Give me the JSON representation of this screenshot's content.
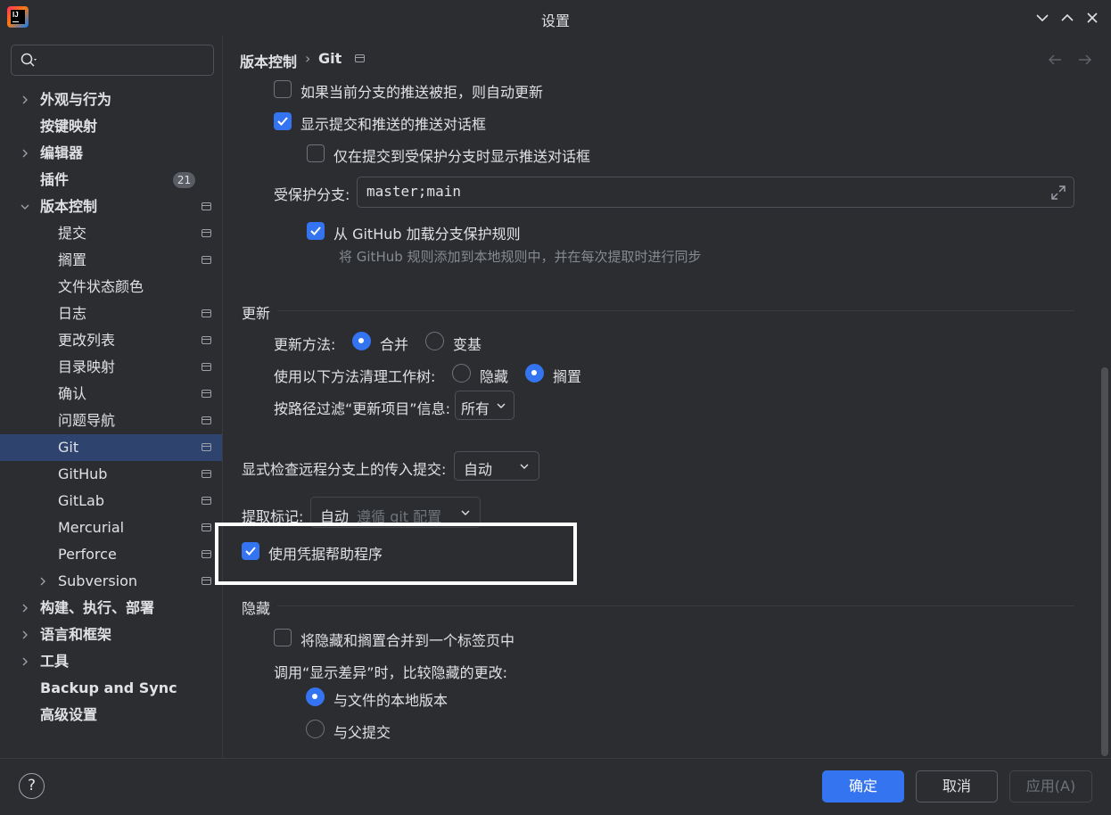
{
  "window": {
    "title": "设置"
  },
  "sidebar": {
    "search_placeholder": "",
    "items": [
      {
        "label": "外观与行为",
        "expandable": true,
        "bold": true
      },
      {
        "label": "按键映射",
        "bold": true
      },
      {
        "label": "编辑器",
        "expandable": true,
        "bold": true
      },
      {
        "label": "插件",
        "bold": true,
        "badge": "21"
      },
      {
        "label": "版本控制",
        "expanded": true,
        "bold": true
      },
      {
        "label": "提交"
      },
      {
        "label": "搁置"
      },
      {
        "label": "文件状态颜色"
      },
      {
        "label": "日志"
      },
      {
        "label": "更改列表"
      },
      {
        "label": "目录映射"
      },
      {
        "label": "确认"
      },
      {
        "label": "问题导航"
      },
      {
        "label": "Git",
        "selected": true
      },
      {
        "label": "GitHub"
      },
      {
        "label": "GitLab"
      },
      {
        "label": "Mercurial"
      },
      {
        "label": "Perforce"
      },
      {
        "label": "Subversion",
        "expandable": true
      },
      {
        "label": "构建、执行、部署",
        "expandable": true,
        "bold": true
      },
      {
        "label": "语言和框架",
        "expandable": true,
        "bold": true
      },
      {
        "label": "工具",
        "expandable": true,
        "bold": true
      },
      {
        "label": "Backup and Sync",
        "bold": true
      },
      {
        "label": "高级设置",
        "bold": true
      }
    ]
  },
  "breadcrumb": {
    "parent": "版本控制",
    "separator": "›",
    "current": "Git"
  },
  "push": {
    "auto_update_label": "如果当前分支的推送被拒，则自动更新",
    "show_push_dialog_label": "显示提交和推送的推送对话框",
    "protected_only_label": "仅在提交到受保护分支时显示推送对话框",
    "protected_branches_label": "受保护分支:",
    "protected_branches_value": "master;main",
    "github_rules_label": "从 GitHub 加载分支保护规则",
    "github_rules_hint": "将 GitHub 规则添加到本地规则中，并在每次提取时进行同步"
  },
  "update": {
    "section_title": "更新",
    "method_label": "更新方法:",
    "merge_label": "合并",
    "rebase_label": "变基",
    "clean_label": "使用以下方法清理工作树:",
    "stash_label": "隐藏",
    "shelve_label": "搁置",
    "filter_label": "按路径过滤“更新项目”信息:",
    "filter_value": "所有"
  },
  "incoming": {
    "label": "显式检查远程分支上的传入提交:",
    "value": "自动"
  },
  "fetch_tags": {
    "label": "提取标记:",
    "value": "自动",
    "value_hint": "遵循 git 配置"
  },
  "credential_helper_label": "使用凭据帮助程序",
  "stash": {
    "section_title": "隐藏",
    "combine_label": "将隐藏和搁置合并到一个标签页中",
    "compare_label": "调用“显示差异”时，比较隐藏的更改:",
    "local_version_label": "与文件的本地版本",
    "parent_commit_label": "与父提交"
  },
  "buttons": {
    "ok": "确定",
    "cancel": "取消",
    "apply": "应用(A)",
    "help": "?"
  },
  "colors": {
    "accent": "#3574f0",
    "selection": "#2e436e",
    "background": "#2b2d30"
  }
}
